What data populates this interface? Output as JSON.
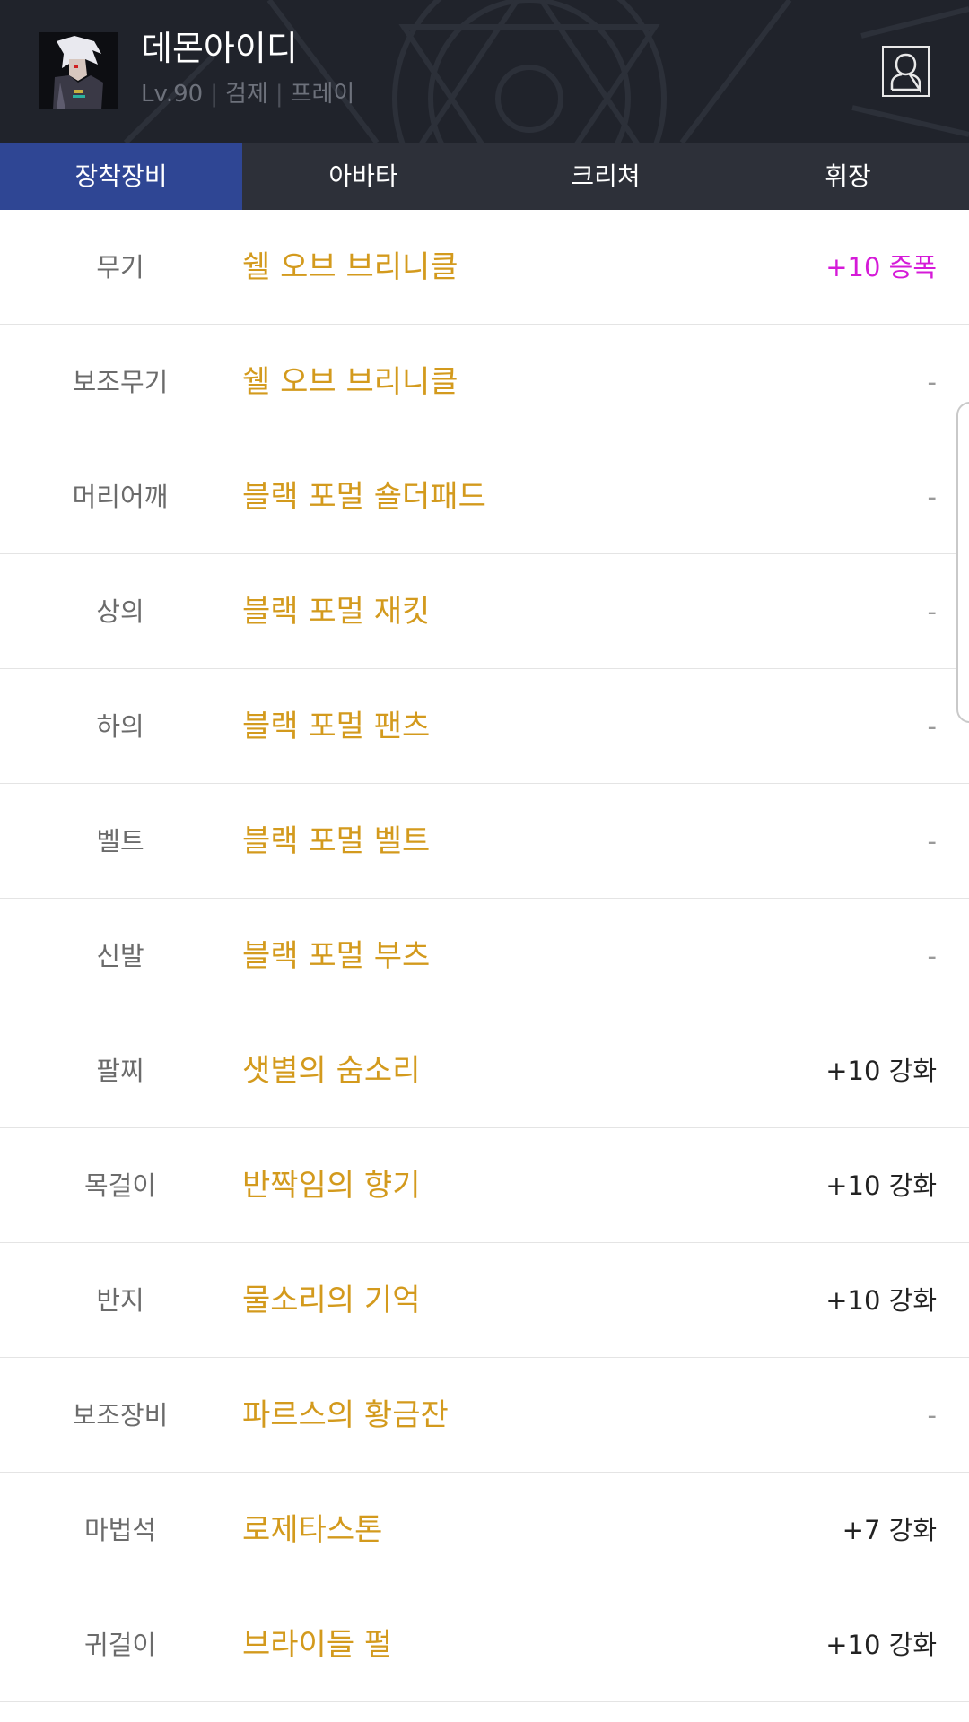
{
  "character": {
    "name": "데몬아이디",
    "level": "Lv.90",
    "job": "검제",
    "server": "프레이",
    "separator": "|"
  },
  "tabs": [
    {
      "label": "장착장비",
      "active": true
    },
    {
      "label": "아바타",
      "active": false
    },
    {
      "label": "크리쳐",
      "active": false
    },
    {
      "label": "휘장",
      "active": false
    }
  ],
  "colors": {
    "header_bg": "#20232b",
    "tab_bar_bg": "#2d3039",
    "tab_active_bg": "#2f4694",
    "item_name": "#d39a1d",
    "amplify": "#d51ad8"
  },
  "equipment": [
    {
      "slot": "무기",
      "item": "쉘 오브 브리니클",
      "enhance": "+10 증폭",
      "type": "amp"
    },
    {
      "slot": "보조무기",
      "item": "쉘 오브 브리니클",
      "enhance": "-",
      "type": "none"
    },
    {
      "slot": "머리어깨",
      "item": "블랙 포멀 숄더패드",
      "enhance": "-",
      "type": "none"
    },
    {
      "slot": "상의",
      "item": "블랙 포멀 재킷",
      "enhance": "-",
      "type": "none"
    },
    {
      "slot": "하의",
      "item": "블랙 포멀 팬츠",
      "enhance": "-",
      "type": "none"
    },
    {
      "slot": "벨트",
      "item": "블랙 포멀 벨트",
      "enhance": "-",
      "type": "none"
    },
    {
      "slot": "신발",
      "item": "블랙 포멀 부츠",
      "enhance": "-",
      "type": "none"
    },
    {
      "slot": "팔찌",
      "item": "샛별의 숨소리",
      "enhance": "+10 강화",
      "type": "reinforce"
    },
    {
      "slot": "목걸이",
      "item": "반짝임의 향기",
      "enhance": "+10 강화",
      "type": "reinforce"
    },
    {
      "slot": "반지",
      "item": "물소리의 기억",
      "enhance": "+10 강화",
      "type": "reinforce"
    },
    {
      "slot": "보조장비",
      "item": "파르스의 황금잔",
      "enhance": "-",
      "type": "none"
    },
    {
      "slot": "마법석",
      "item": "로제타스톤",
      "enhance": "+7 강화",
      "type": "reinforce"
    },
    {
      "slot": "귀걸이",
      "item": "브라이들 펄",
      "enhance": "+10 강화",
      "type": "reinforce"
    }
  ]
}
